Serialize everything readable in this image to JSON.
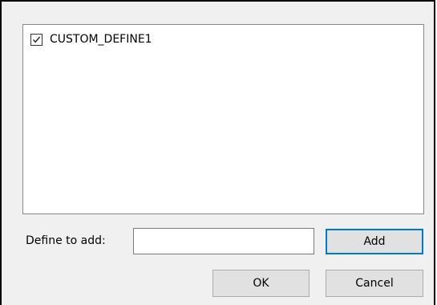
{
  "list": {
    "items": [
      {
        "label": "CUSTOM_DEFINE1",
        "checked": true
      }
    ]
  },
  "define_field": {
    "label": "Define to add:",
    "value": ""
  },
  "buttons": {
    "add": "Add",
    "ok": "OK",
    "cancel": "Cancel"
  },
  "colors": {
    "dialog_background": "#f0f0f0",
    "button_face": "#e1e1e1",
    "default_button_border": "#0078d7",
    "list_border": "#828790"
  },
  "icons": {
    "checkbox": "checkmark-icon"
  }
}
